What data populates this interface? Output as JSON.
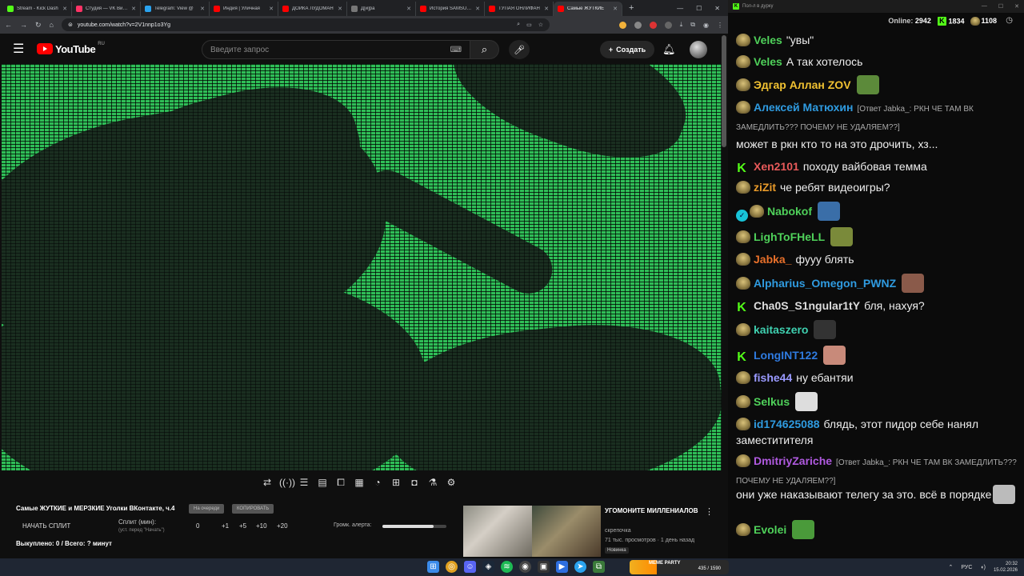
{
  "browser": {
    "tabs": [
      {
        "title": "Stream - Kick Dash",
        "color": "#53fc18"
      },
      {
        "title": "Студия — VK Видео",
        "color": "#ff3366"
      },
      {
        "title": "Telegram: View @",
        "color": "#2aa3ef"
      },
      {
        "title": "Индия | Уличная",
        "color": "#ff0000"
      },
      {
        "title": "ДОЙКА ЛУДОМАН",
        "color": "#ff0000"
      },
      {
        "title": "Д[и]ра",
        "color": "#777777"
      },
      {
        "title": "История SAMSUNG",
        "color": "#ff0000"
      },
      {
        "title": "ТУПАЯ ОНЛИФАН",
        "color": "#ff0000"
      },
      {
        "title": "Самые ЖУТКИЕ",
        "color": "#ff0000"
      }
    ],
    "new_tab": "+",
    "url": "youtube.com/watch?v=2V1nnp1o3Yg"
  },
  "youtube": {
    "logo_text": "YouTube",
    "region": "RU",
    "search_placeholder": "Введите запрос",
    "create_label": "Создать"
  },
  "controls": {
    "video_title": "Самые ЖУТКИЕ и МЕРЗКИЕ Уголки ВКонтакте, ч.4",
    "chip_queue": "На очереди",
    "chip_copy": "КОПИРОВАТЬ",
    "start_split": "НАЧАТЬ СПЛИТ",
    "split_label": "Сплит (мин):",
    "split_hint": "(уст. перед \"Начать\")",
    "split_values": [
      "0",
      "+1",
      "+5",
      "+10",
      "+20"
    ],
    "alert_label": "Громк. алерта:",
    "alert_volume": 0.8,
    "bought": "Выкуплено: 0 / Всего: ? минут"
  },
  "recommendation": {
    "title": "УГОМОНИТЕ МИЛЛЕНИАЛОВ",
    "channel": "скрепочка",
    "meta": "71 тыс. просмотров · 1 день назад",
    "badge": "Новинка"
  },
  "chat": {
    "window_title": "Пол-л в дурку",
    "online_label": "Online:",
    "online_count": "2942",
    "kick_count": "1834",
    "second_count": "1108",
    "messages": [
      {
        "nick": "Veles",
        "color": "#4fd15a",
        "text": "\"увы\"",
        "badge": "hat",
        "emote": ""
      },
      {
        "nick": "Veles",
        "color": "#4fd15a",
        "text": "А так хотелось",
        "badge": "hat",
        "emote": ""
      },
      {
        "nick": "Эдгар Аллан ZOV",
        "color": "#f1c232",
        "text": "",
        "badge": "hat",
        "emote": "#5c8a3a"
      },
      {
        "nick": "Алексей Матюхин",
        "color": "#2f9be0",
        "text": "",
        "badge": "hat",
        "emote": "",
        "reply": "[Ответ Jabka_: РКН ЧЕ ТАМ ВК ЗАМЕДЛИТЬ??? ПОЧЕМУ НЕ УДАЛЯЕМ??]"
      },
      {
        "nick": "",
        "color": "#eee",
        "text": "может в ркн кто то на это дрочить, хз...",
        "badge": "",
        "emote": ""
      },
      {
        "nick": "Xen2101",
        "color": "#e85a5a",
        "text": "походу вайбовая темма",
        "badge": "kick",
        "emote": ""
      },
      {
        "nick": "ziZit",
        "color": "#e89a2a",
        "text": "че ребят видеоигры?",
        "badge": "hat",
        "emote": ""
      },
      {
        "nick": "Nabokof",
        "color": "#4fd15a",
        "text": "",
        "badge": "verified",
        "emote": "#3a6ea8"
      },
      {
        "nick": "LighToFHeLL",
        "color": "#4fd15a",
        "text": "",
        "badge": "hat",
        "emote": "#7a8a3a"
      },
      {
        "nick": "Jabka_",
        "color": "#e8702a",
        "text": "фууу блять",
        "badge": "hat",
        "emote": ""
      },
      {
        "nick": "Alpharius_Omegon_PWNZ",
        "color": "#2f9be0",
        "text": "",
        "badge": "hat",
        "emote": "#8a5a4a"
      },
      {
        "nick": "Cha0S_S1ngular1tY",
        "color": "#dddddd",
        "text": "бля, нахуя?",
        "badge": "kick",
        "emote": ""
      },
      {
        "nick": "kaitaszero",
        "color": "#3fd0b0",
        "text": "",
        "badge": "hat",
        "emote": "#333333"
      },
      {
        "nick": "LongINT122",
        "color": "#2f7be0",
        "text": "",
        "badge": "kick",
        "emote": "#c88a7a"
      },
      {
        "nick": "fishe44",
        "color": "#9a9aff",
        "text": "ну ебантяи",
        "badge": "hat",
        "emote": ""
      },
      {
        "nick": "Selkus",
        "color": "#4fd15a",
        "text": "",
        "badge": "hat",
        "emote": "#dddddd"
      },
      {
        "nick": "id174625088",
        "color": "#2f9be0",
        "text": "блядь, этот пидор себе нанял заместитителя",
        "badge": "hat",
        "emote": ""
      },
      {
        "nick": "DmitriyZariche",
        "color": "#b05ae0",
        "text": "",
        "badge": "hat",
        "emote": "",
        "reply": "[Ответ Jabka_: РКН ЧЕ ТАМ ВК ЗАМЕДЛИТЬ??? ПОЧЕМУ НЕ УДАЛЯЕМ??]"
      },
      {
        "nick": "",
        "color": "#eee",
        "text": "они уже наказывают телегу за это. всё в порядке",
        "badge": "",
        "emote": "#bbbbbb"
      },
      {
        "nick": "Evolei",
        "color": "#4fd15a",
        "text": "",
        "badge": "hat",
        "emote": "#4a9a3a"
      }
    ]
  },
  "taskbar": {
    "meme_label": "MEME PARTY",
    "meme_progress": "435 / 1590",
    "meme_fraction": 0.2736,
    "lang": "РУС",
    "time": "20:32",
    "date": "15.02.2026"
  }
}
